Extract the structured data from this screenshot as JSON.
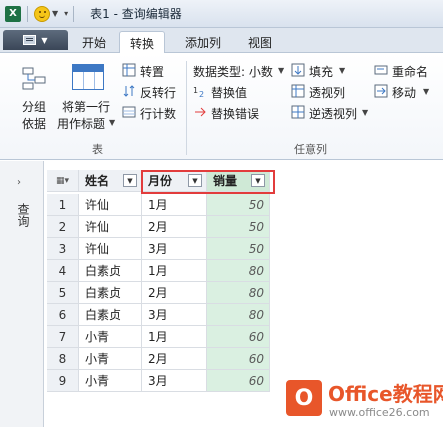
{
  "window": {
    "title": "表1 - 查询编辑器"
  },
  "tabs": [
    {
      "label": "开始",
      "active": false
    },
    {
      "label": "转换",
      "active": true
    },
    {
      "label": "添加列",
      "active": false
    },
    {
      "label": "视图",
      "active": false
    }
  ],
  "ribbon": {
    "table_group": {
      "label": "表",
      "group_by": [
        "分组",
        "依据"
      ],
      "use_first_row": [
        "将第一行",
        "用作标题"
      ],
      "transpose": "转置",
      "reverse_rows": "反转行",
      "count_rows": "行计数"
    },
    "any_column_group": {
      "label": "任意列",
      "data_type": "数据类型: 小数",
      "fill": "填充",
      "rename": "重命名",
      "replace_values": "替换值",
      "pivot_column": "透视列",
      "move": "移动",
      "replace_errors": "替换错误",
      "unpivot_columns": "逆透视列"
    }
  },
  "query_panel": {
    "label": "查询"
  },
  "table": {
    "columns": [
      "姓名",
      "月份",
      "销量"
    ],
    "rows": [
      {
        "idx": "1",
        "name": "许仙",
        "month": "1月",
        "sales": "50"
      },
      {
        "idx": "2",
        "name": "许仙",
        "month": "2月",
        "sales": "50"
      },
      {
        "idx": "3",
        "name": "许仙",
        "month": "3月",
        "sales": "50"
      },
      {
        "idx": "4",
        "name": "白素贞",
        "month": "1月",
        "sales": "80"
      },
      {
        "idx": "5",
        "name": "白素贞",
        "month": "2月",
        "sales": "80"
      },
      {
        "idx": "6",
        "name": "白素贞",
        "month": "3月",
        "sales": "80"
      },
      {
        "idx": "7",
        "name": "小青",
        "month": "1月",
        "sales": "60"
      },
      {
        "idx": "8",
        "name": "小青",
        "month": "2月",
        "sales": "60"
      },
      {
        "idx": "9",
        "name": "小青",
        "month": "3月",
        "sales": "60"
      }
    ]
  },
  "watermark": {
    "title": "Office教程网",
    "url": "www.office26.com"
  },
  "colors": {
    "highlight": "#e23c3c",
    "selected_column": "#daf0e1",
    "brand": "#e8562a"
  }
}
